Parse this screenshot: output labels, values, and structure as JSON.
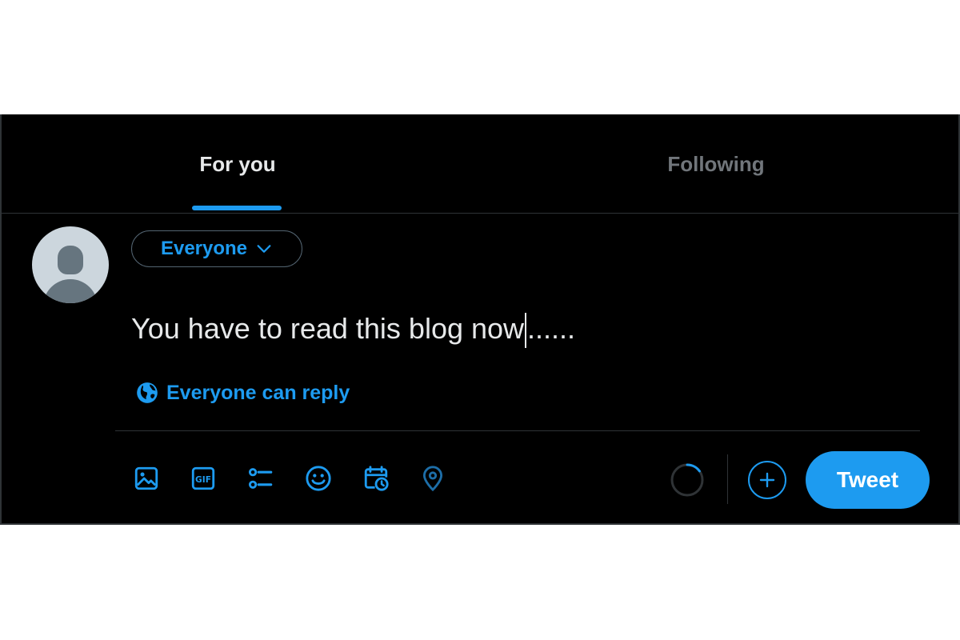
{
  "tabs": [
    {
      "label": "For you",
      "active": true
    },
    {
      "label": "Following",
      "active": false
    }
  ],
  "composer": {
    "audience_label": "Everyone",
    "text_before_caret": "You have to read this blog now",
    "text_after_caret": "......",
    "reply_setting": "Everyone can reply",
    "char_progress": 0.15
  },
  "toolbar": {
    "icons": [
      "image-icon",
      "gif-icon",
      "poll-icon",
      "emoji-icon",
      "schedule-icon",
      "location-icon"
    ],
    "tweet_label": "Tweet"
  },
  "colors": {
    "accent": "#1d9bf0",
    "background": "#000000",
    "text": "#e7e9ea",
    "muted": "#71767b",
    "border": "#2f3336"
  }
}
